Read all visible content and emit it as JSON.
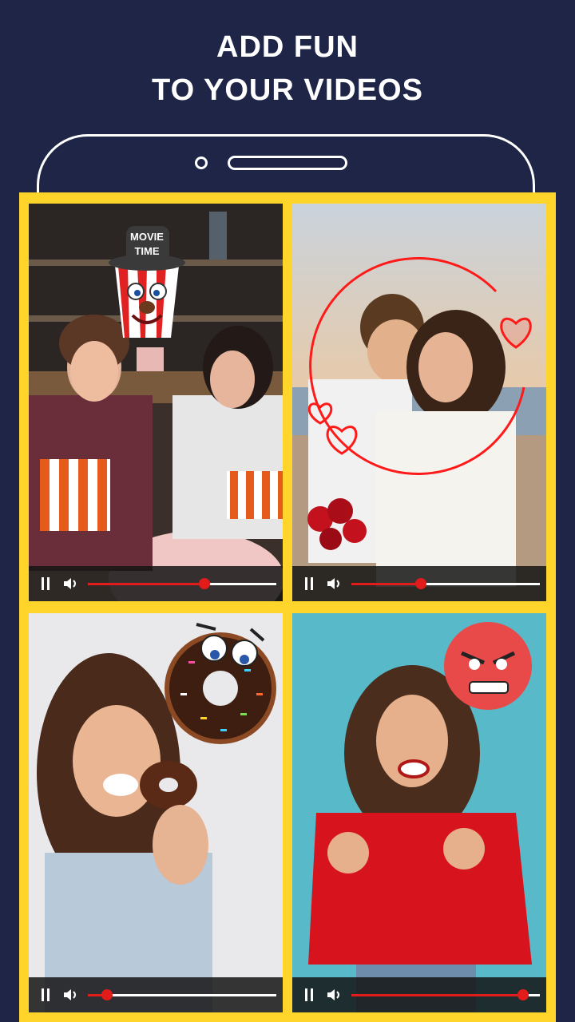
{
  "headline": {
    "line1": "ADD FUN",
    "line2": "TO YOUR VIDEOS"
  },
  "colors": {
    "background": "#1e2547",
    "frame": "#ffd52b",
    "progress": "#e21b1b"
  },
  "videos": [
    {
      "name": "friends-popcorn",
      "sticker": "movie-time-popcorn-sticker",
      "sticker_text_line1": "MOVIE",
      "sticker_text_line2": "TIME",
      "progress": 0.62
    },
    {
      "name": "couple-beach",
      "sticker": "neon-hearts-sticker",
      "progress": 0.37
    },
    {
      "name": "woman-donut",
      "sticker": "donut-face-sticker",
      "progress": 0.1
    },
    {
      "name": "angry-woman",
      "sticker": "angry-emoji-sticker",
      "progress": 0.91
    }
  ],
  "icons": {
    "pause": "pause-icon",
    "volume": "volume-icon"
  }
}
